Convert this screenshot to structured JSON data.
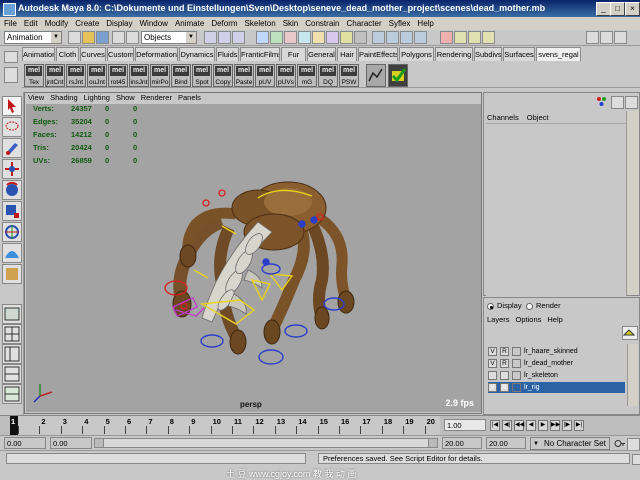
{
  "window": {
    "title": "Autodesk Maya 8.0: C:\\Dokumente und Einstellungen\\Sven\\Desktop\\seneve_dead_mother_project\\scenes\\dead_mother.mb"
  },
  "menubar": [
    "File",
    "Edit",
    "Modify",
    "Create",
    "Display",
    "Window",
    "Animate",
    "Deform",
    "Skeleton",
    "Skin",
    "Constrain",
    "Character",
    "Syflex",
    "Help"
  ],
  "statusline": {
    "menuset": "Animation",
    "selection_mode": "Objects"
  },
  "shelf_tabs": [
    "Animation",
    "Cloth",
    "Curves",
    "Custom",
    "Deformation",
    "Dynamics",
    "Fluids",
    "FranticFilms",
    "Fur",
    "General",
    "Hair",
    "PaintEffects",
    "Polygons",
    "Rendering",
    "Subdivs",
    "Surfaces",
    "svens_regal"
  ],
  "shelf_active": "svens_regal",
  "shelf_buttons": [
    "Tex",
    "jntCnt",
    "rsJnt",
    "ouJnt",
    "rot45",
    "insJnt",
    "mirPo",
    "Bind",
    "Spot",
    "Copy",
    "Paste",
    "pUV",
    "pUVs",
    "mG",
    "DQ",
    "PSW"
  ],
  "shelf_mel_label": "mel",
  "panel_menu": [
    "View",
    "Shading",
    "Lighting",
    "Show",
    "Renderer",
    "Panels"
  ],
  "hud": [
    {
      "label": "Verts:",
      "v1": "24357",
      "v2": "0",
      "v3": "0"
    },
    {
      "label": "Edges:",
      "v1": "35204",
      "v2": "0",
      "v3": "0"
    },
    {
      "label": "Faces:",
      "v1": "14212",
      "v2": "0",
      "v3": "0"
    },
    {
      "label": "Tris:",
      "v1": "20424",
      "v2": "0",
      "v3": "0"
    },
    {
      "label": "UVs:",
      "v1": "26859",
      "v2": "0",
      "v3": "0"
    }
  ],
  "viewport": {
    "camera": "persp",
    "fps": "2.9 fps"
  },
  "channel_box": {
    "tab_channels": "Channels",
    "tab_object": "Object"
  },
  "layer_editor": {
    "display_label": "Display",
    "render_label": "Render",
    "menu": [
      "Layers",
      "Options",
      "Help"
    ],
    "layers": [
      {
        "v": "V",
        "r": "R",
        "name": "lr_haare_skinned",
        "selected": false
      },
      {
        "v": "V",
        "r": "R",
        "name": "lr_dead_mother",
        "selected": false
      },
      {
        "v": "",
        "r": "",
        "name": "lr_skeleton",
        "selected": false
      },
      {
        "v": "V",
        "r": "R",
        "name": "lr_rig",
        "selected": true
      }
    ]
  },
  "timeline": {
    "ticks": [
      "1",
      "2",
      "3",
      "4",
      "5",
      "6",
      "7",
      "8",
      "9",
      "10",
      "11",
      "12",
      "13",
      "14",
      "15",
      "16",
      "17",
      "18",
      "19",
      "20"
    ],
    "current_frame_label": "1",
    "current_time": "1.00"
  },
  "range": {
    "start": "0.00",
    "inner_start": "0.00",
    "inner_end": "20.00",
    "end": "20.00",
    "character_set": "No Character Set"
  },
  "feedback": "Preferences saved. See Script Editor for details.",
  "watermark": "土 豆 www.cgjoy.com 教 我 动 画"
}
